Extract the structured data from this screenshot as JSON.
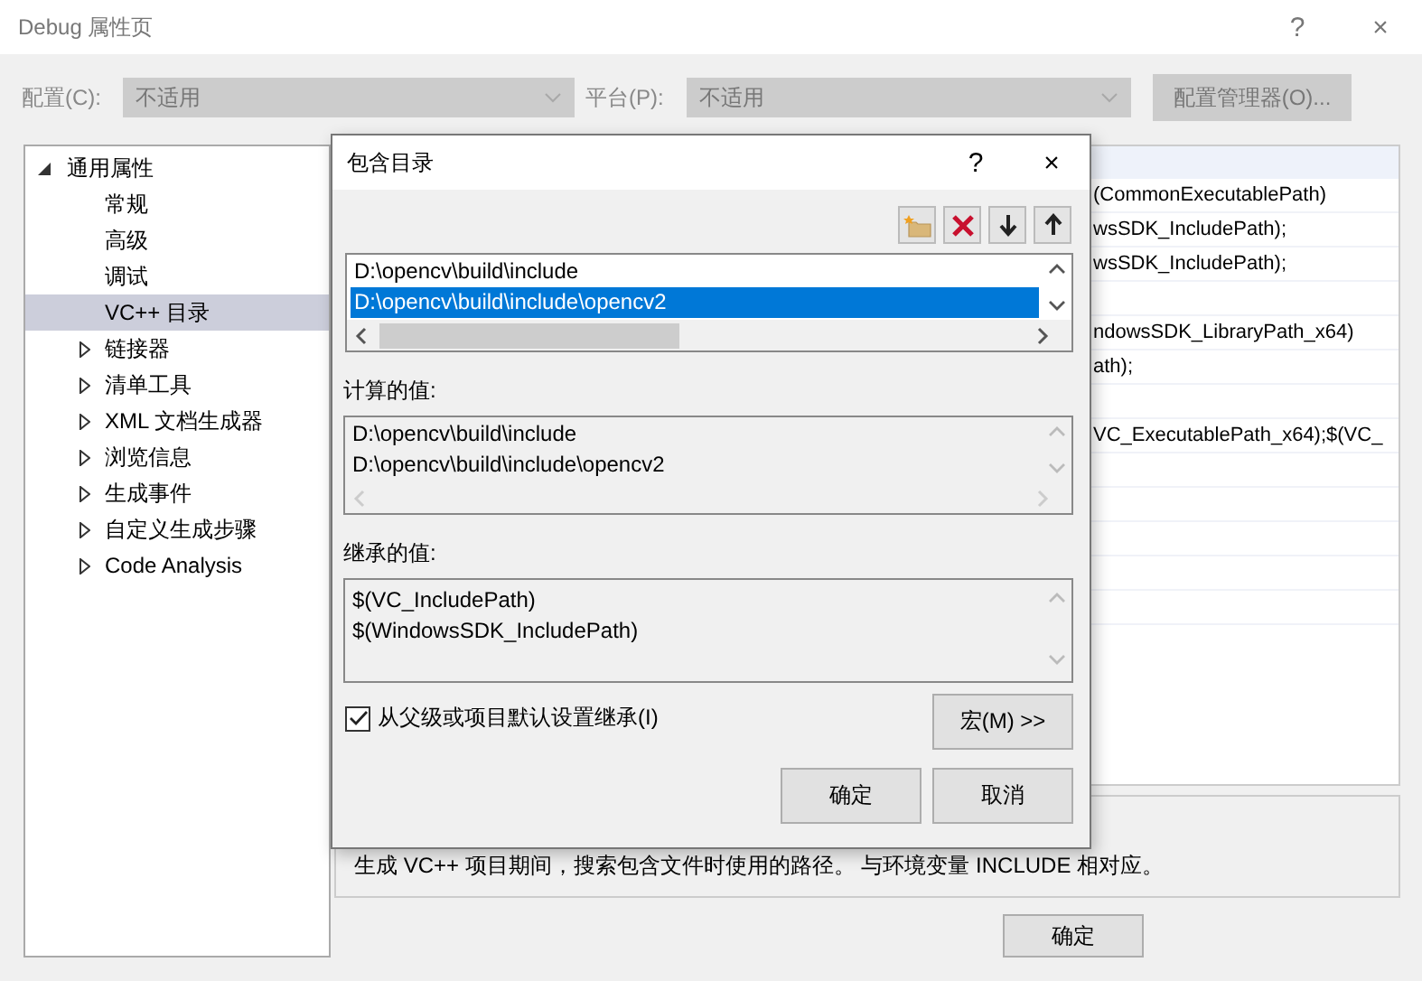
{
  "window": {
    "title": "Debug 属性页",
    "buttons": [
      "?",
      "×"
    ]
  },
  "configuration": {
    "label": "配置(C):",
    "value": "不适用",
    "disabled": true
  },
  "platform": {
    "label": "平台(P):",
    "value": "不适用",
    "disabled": true
  },
  "config_manager_button": {
    "label": "配置管理器(O)...",
    "disabled": true
  },
  "tree": [
    {
      "label": "通用属性",
      "expanded": true,
      "selected": false,
      "children": [
        {
          "label": "常规",
          "selected": false
        },
        {
          "label": "高级",
          "selected": false
        },
        {
          "label": "调试",
          "selected": false
        },
        {
          "label": "VC++ 目录",
          "selected": true
        },
        {
          "label": "链接器",
          "selected": false,
          "expanded": false
        },
        {
          "label": "清单工具",
          "selected": false,
          "expanded": false
        },
        {
          "label": "XML 文档生成器",
          "selected": false,
          "expanded": false
        },
        {
          "label": "浏览信息",
          "selected": false,
          "expanded": false
        },
        {
          "label": "生成事件",
          "selected": false,
          "expanded": false
        },
        {
          "label": "自定义生成步骤",
          "selected": false,
          "expanded": false
        },
        {
          "label": "Code Analysis",
          "selected": false,
          "expanded": false
        }
      ]
    }
  ],
  "property_rows": [
    {
      "value": "(CommonExecutablePath)"
    },
    {
      "value": "wsSDK_IncludePath);"
    },
    {
      "value": "wsSDK_IncludePath);"
    },
    {},
    {
      "value": "ndowsSDK_LibraryPath_x64)"
    },
    {
      "value": "ath);"
    },
    {},
    {
      "value": "VC_ExecutablePath_x64);$(VC_"
    },
    {},
    {},
    {},
    {},
    {}
  ],
  "description": "生成 VC++ 项目期间，搜索包含文件时使用的路径。 与环境变量 INCLUDE 相对应。",
  "bottom_buttons": [
    "确定"
  ],
  "dialog": {
    "title": "包含目录",
    "buttons": [
      "?",
      "×"
    ],
    "toolbar": [
      {
        "kind": "new-folder"
      },
      {
        "kind": "delete"
      },
      {
        "kind": "down"
      },
      {
        "kind": "up"
      }
    ],
    "entries": [
      {
        "text": "D:\\opencv\\build\\include",
        "selected": false
      },
      {
        "text": "D:\\opencv\\build\\include\\opencv2",
        "selected": true
      }
    ],
    "computed_label": "计算的值:",
    "computed": [
      "D:\\opencv\\build\\include",
      "D:\\opencv\\build\\include\\opencv2"
    ],
    "inherited_label": "继承的值:",
    "inherited": [
      "$(VC_IncludePath)",
      "$(WindowsSDK_IncludePath)"
    ],
    "inherit_checkbox": {
      "label": "从父级或项目默认设置继承(I)",
      "checked": true
    },
    "macro_button": "宏(M) >>",
    "actions": [
      "确定",
      "取消"
    ]
  }
}
